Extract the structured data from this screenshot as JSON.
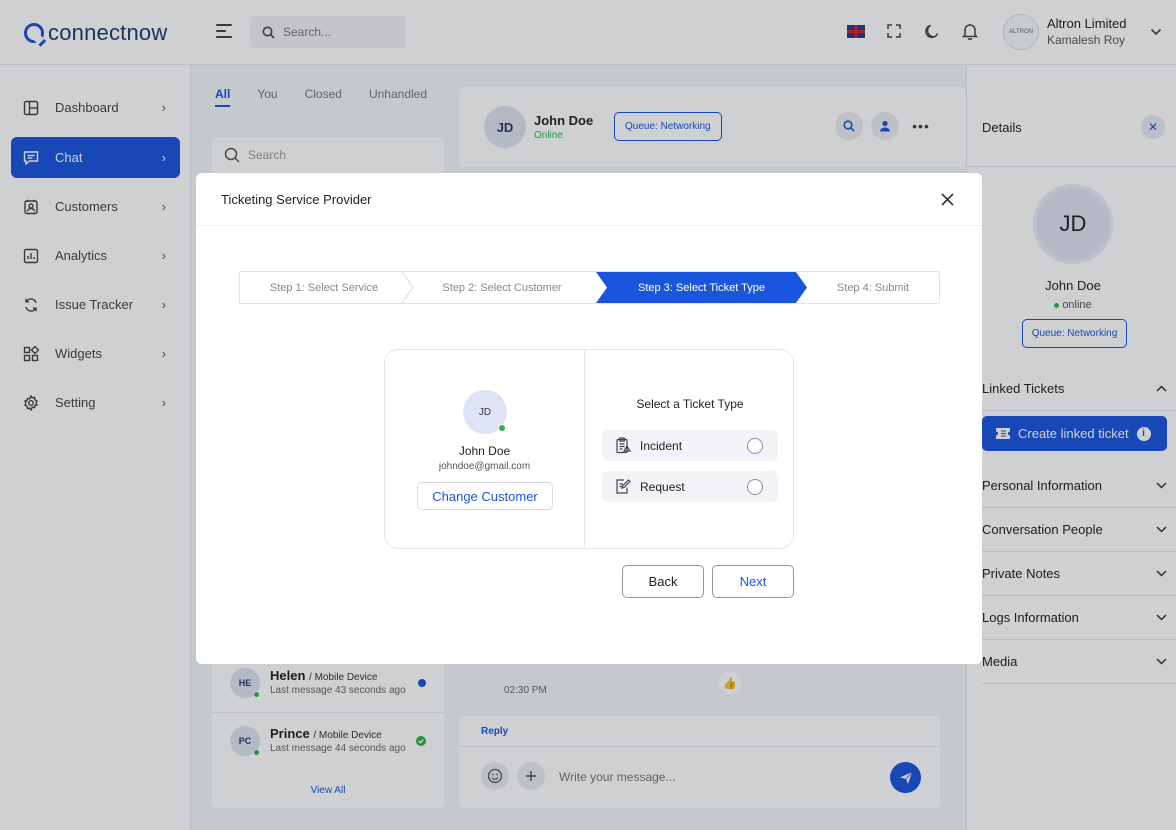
{
  "brand": {
    "name": "connectnow"
  },
  "header": {
    "search_placeholder": "Search...",
    "company": "Altron Limited",
    "user": "Kamalesh Roy",
    "avatar_text": "ALTRON"
  },
  "sidebar": {
    "items": [
      {
        "label": "Dashboard",
        "icon": "dashboard-icon"
      },
      {
        "label": "Chat",
        "icon": "chat-icon"
      },
      {
        "label": "Customers",
        "icon": "customers-icon"
      },
      {
        "label": "Analytics",
        "icon": "analytics-icon"
      },
      {
        "label": "Issue Tracker",
        "icon": "issue-tracker-icon"
      },
      {
        "label": "Widgets",
        "icon": "widgets-icon"
      },
      {
        "label": "Setting",
        "icon": "gear-icon"
      }
    ],
    "active": "Chat"
  },
  "conversations": {
    "tabs": [
      "All",
      "You",
      "Closed",
      "Unhandled"
    ],
    "active_tab": "All",
    "search_placeholder": "Search",
    "items": [
      {
        "initials": "HE",
        "name": "Helen",
        "device": "/ Mobile Device",
        "last": "Last message 43 seconds ago",
        "status": "unread"
      },
      {
        "initials": "PC",
        "name": "Prince",
        "device": "/ Mobile Device",
        "last": "Last message 44 seconds ago",
        "status": "read"
      }
    ],
    "view_all": "View All"
  },
  "chat": {
    "initials": "JD",
    "name": "John Doe",
    "status": "Online",
    "queue": "Queue: Networking",
    "message_time": "02:30 PM",
    "reply_tab": "Reply",
    "input_placeholder": "Write your message..."
  },
  "details": {
    "title": "Details",
    "initials": "JD",
    "name": "John Doe",
    "status": "online",
    "queue": "Queue: Networking",
    "linked_tickets": "Linked Tickets",
    "create_linked": "Create linked ticket",
    "sections": [
      "Personal Information",
      "Conversation People",
      "Private Notes",
      "Logs Information",
      "Media"
    ]
  },
  "modal": {
    "title": "Ticketing Service Provider",
    "steps": [
      "Step 1: Select Service",
      "Step 2: Select Customer",
      "Step 3: Select Ticket Type",
      "Step 4: Submit"
    ],
    "active_step": 3,
    "customer": {
      "initials": "JD",
      "name": "John Doe",
      "email": "johndoe@gmail.com"
    },
    "change_customer": "Change Customer",
    "ticket_type_title": "Select a Ticket Type",
    "ticket_types": [
      {
        "label": "Incident",
        "icon": "incident-clipboard-icon",
        "selected": false
      },
      {
        "label": "Request",
        "icon": "request-edit-icon",
        "selected": false
      }
    ],
    "back": "Back",
    "next": "Next"
  },
  "colors": {
    "primary": "#1a56db",
    "online": "#2fb34a",
    "unread": "#1a56db"
  }
}
